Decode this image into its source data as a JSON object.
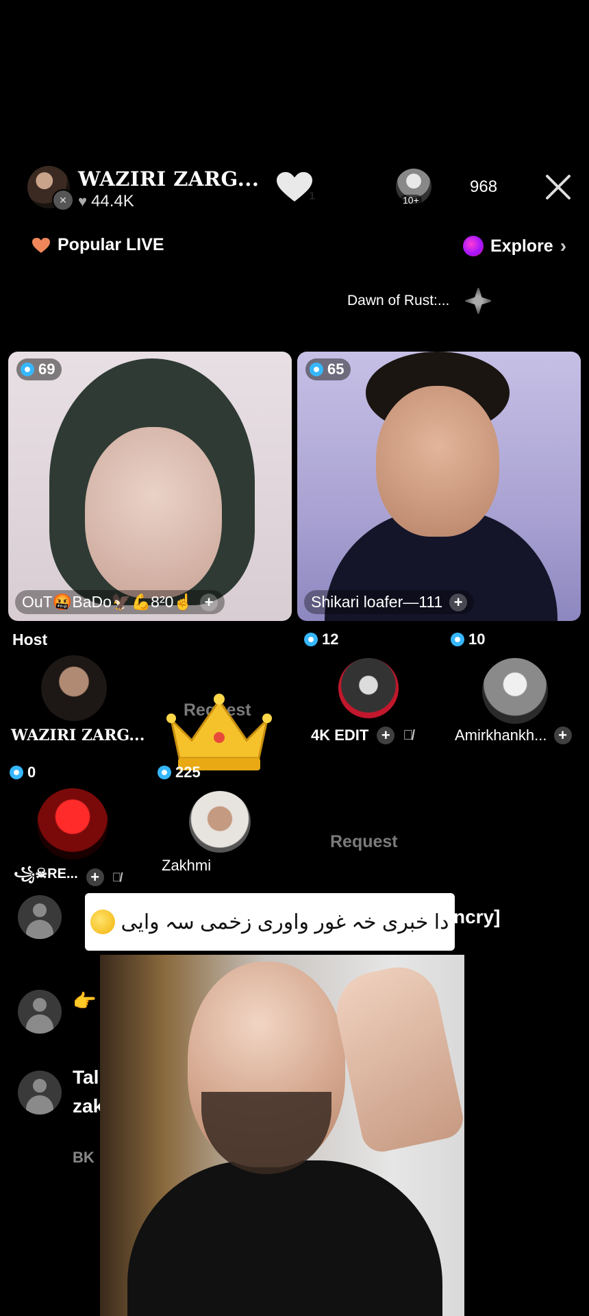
{
  "header": {
    "host_name": "WAZIRI ZARG...",
    "likes": "44.4K",
    "heart_count": "1",
    "viewer_badge": "10+",
    "viewer_count": "968",
    "popular_label": "Popular LIVE",
    "explore_label": "Explore",
    "game_label": "Dawn of Rust:..."
  },
  "tiles": [
    {
      "count": "69",
      "name": "OuT🤬BaDo🦅💪8²0☝"
    },
    {
      "count": "65",
      "name": "Shikari loafer—111"
    }
  ],
  "seats": {
    "host_label": "Host",
    "host_name": "WAZIRI ZARG...",
    "request_label": "Request",
    "seat1": {
      "count": "12",
      "name": "4K EDIT"
    },
    "seat2": {
      "count": "10",
      "name": "Amirkhankh..."
    },
    "seat3": {
      "count": "0",
      "name": "꧁☠RE..."
    },
    "seat4": {
      "count": "225",
      "name": "Zakhmi"
    },
    "request2_label": "Request"
  },
  "chat": {
    "bubble_text": "دا خبری خہ غور واوری زخمی سہ وایی",
    "line1_suffix": "ncry]",
    "line3": "👉",
    "line4a": "Tal",
    "line4b": "zak",
    "line5": "BK"
  }
}
